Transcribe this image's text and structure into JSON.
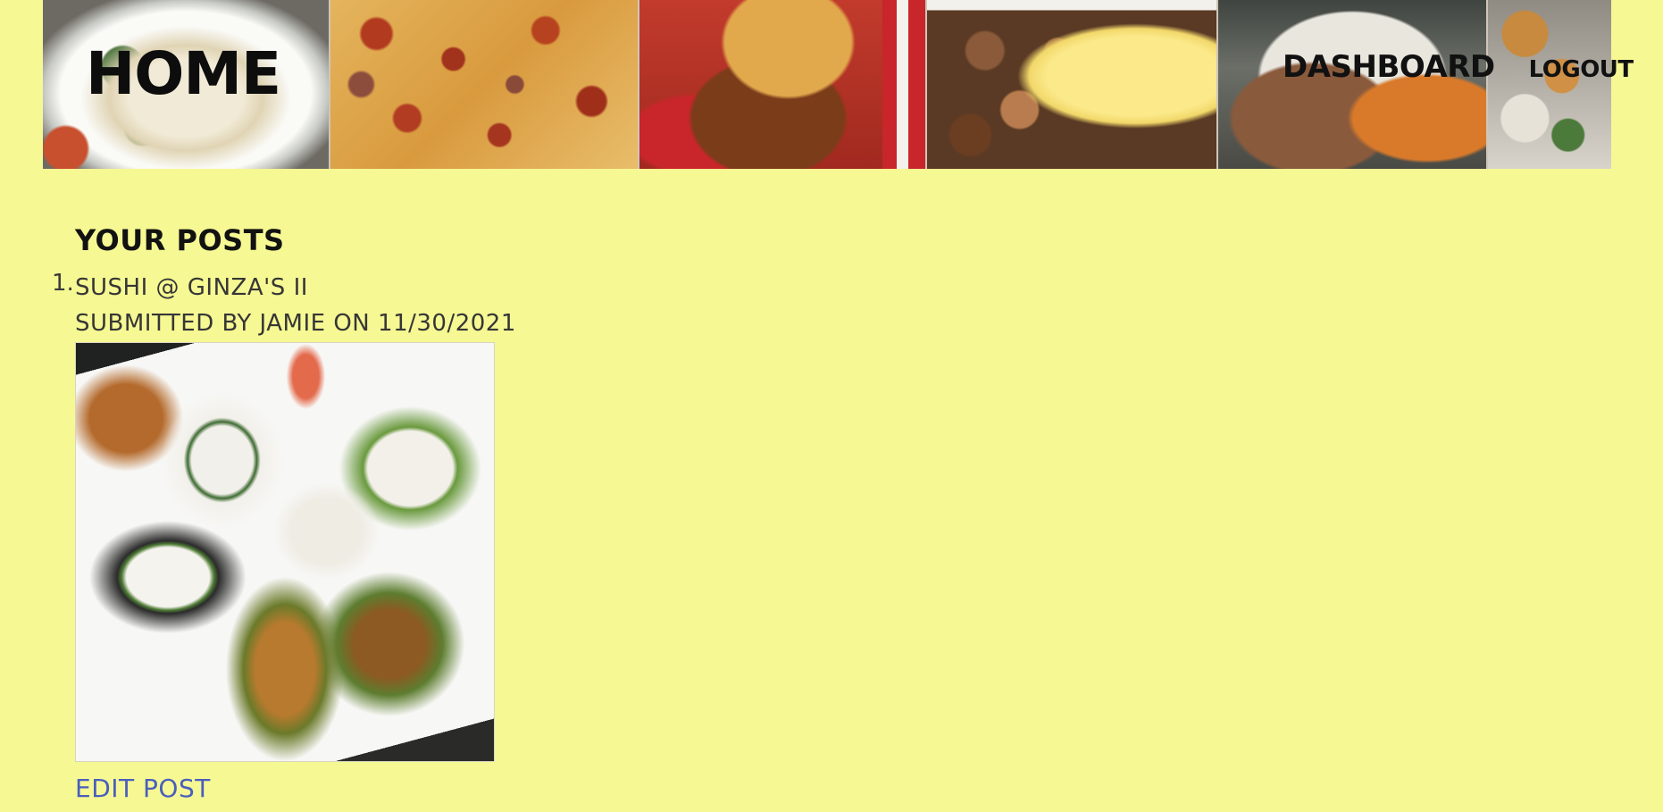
{
  "colors": {
    "background": "#f6f893",
    "text": "#121212",
    "muted_text": "#363636",
    "link": "#4a5fbd"
  },
  "header": {
    "brand_label": "HOME",
    "banner_images": [
      "pasta-photo",
      "pizza-photo",
      "burger-photo",
      "breakfast-photo",
      "noodles-fries-photo",
      "sushi-photo"
    ],
    "nav": {
      "dashboard_label": "DASHBOARD",
      "logout_label": "LOGOUT"
    }
  },
  "main": {
    "section_title": "YOUR POSTS",
    "posts": [
      {
        "number": "1.",
        "title": "SUSHI @ GINZA'S II",
        "meta": "SUBMITTED BY JAMIE ON 11/30/2021",
        "image": "sushi-platter-photo",
        "edit_label": "EDIT POST"
      }
    ]
  }
}
